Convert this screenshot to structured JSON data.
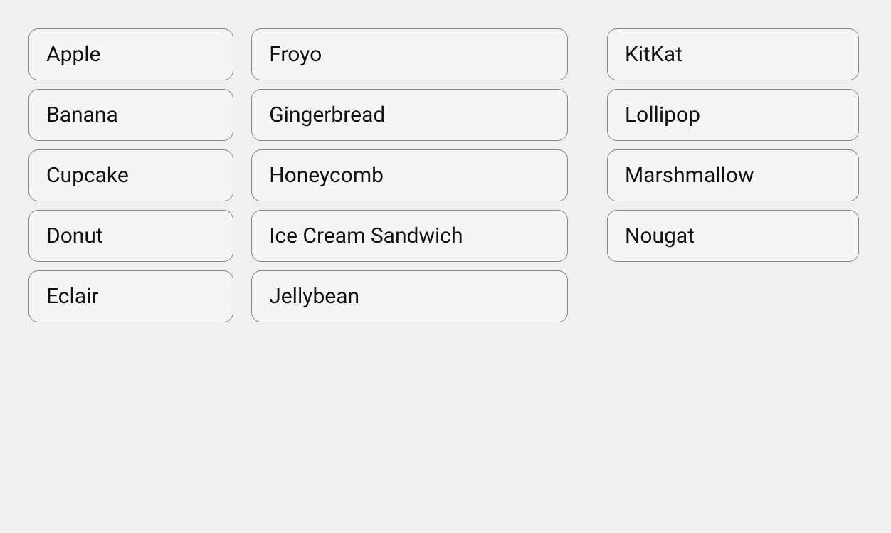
{
  "columns": [
    {
      "id": "col1",
      "items": [
        {
          "id": "apple",
          "label": "Apple"
        },
        {
          "id": "banana",
          "label": "Banana"
        },
        {
          "id": "cupcake",
          "label": "Cupcake"
        },
        {
          "id": "donut",
          "label": "Donut"
        },
        {
          "id": "eclair",
          "label": "Eclair"
        }
      ]
    },
    {
      "id": "col2",
      "items": [
        {
          "id": "froyo",
          "label": "Froyo"
        },
        {
          "id": "gingerbread",
          "label": "Gingerbread"
        },
        {
          "id": "honeycomb",
          "label": "Honeycomb"
        },
        {
          "id": "ice-cream-sandwich",
          "label": "Ice Cream Sandwich"
        },
        {
          "id": "jellybean",
          "label": "Jellybean"
        }
      ]
    },
    {
      "id": "col3",
      "items": [
        {
          "id": "kitkat",
          "label": "KitKat"
        },
        {
          "id": "lollipop",
          "label": "Lollipop"
        },
        {
          "id": "marshmallow",
          "label": "Marshmallow"
        },
        {
          "id": "nougat",
          "label": "Nougat"
        }
      ]
    }
  ]
}
